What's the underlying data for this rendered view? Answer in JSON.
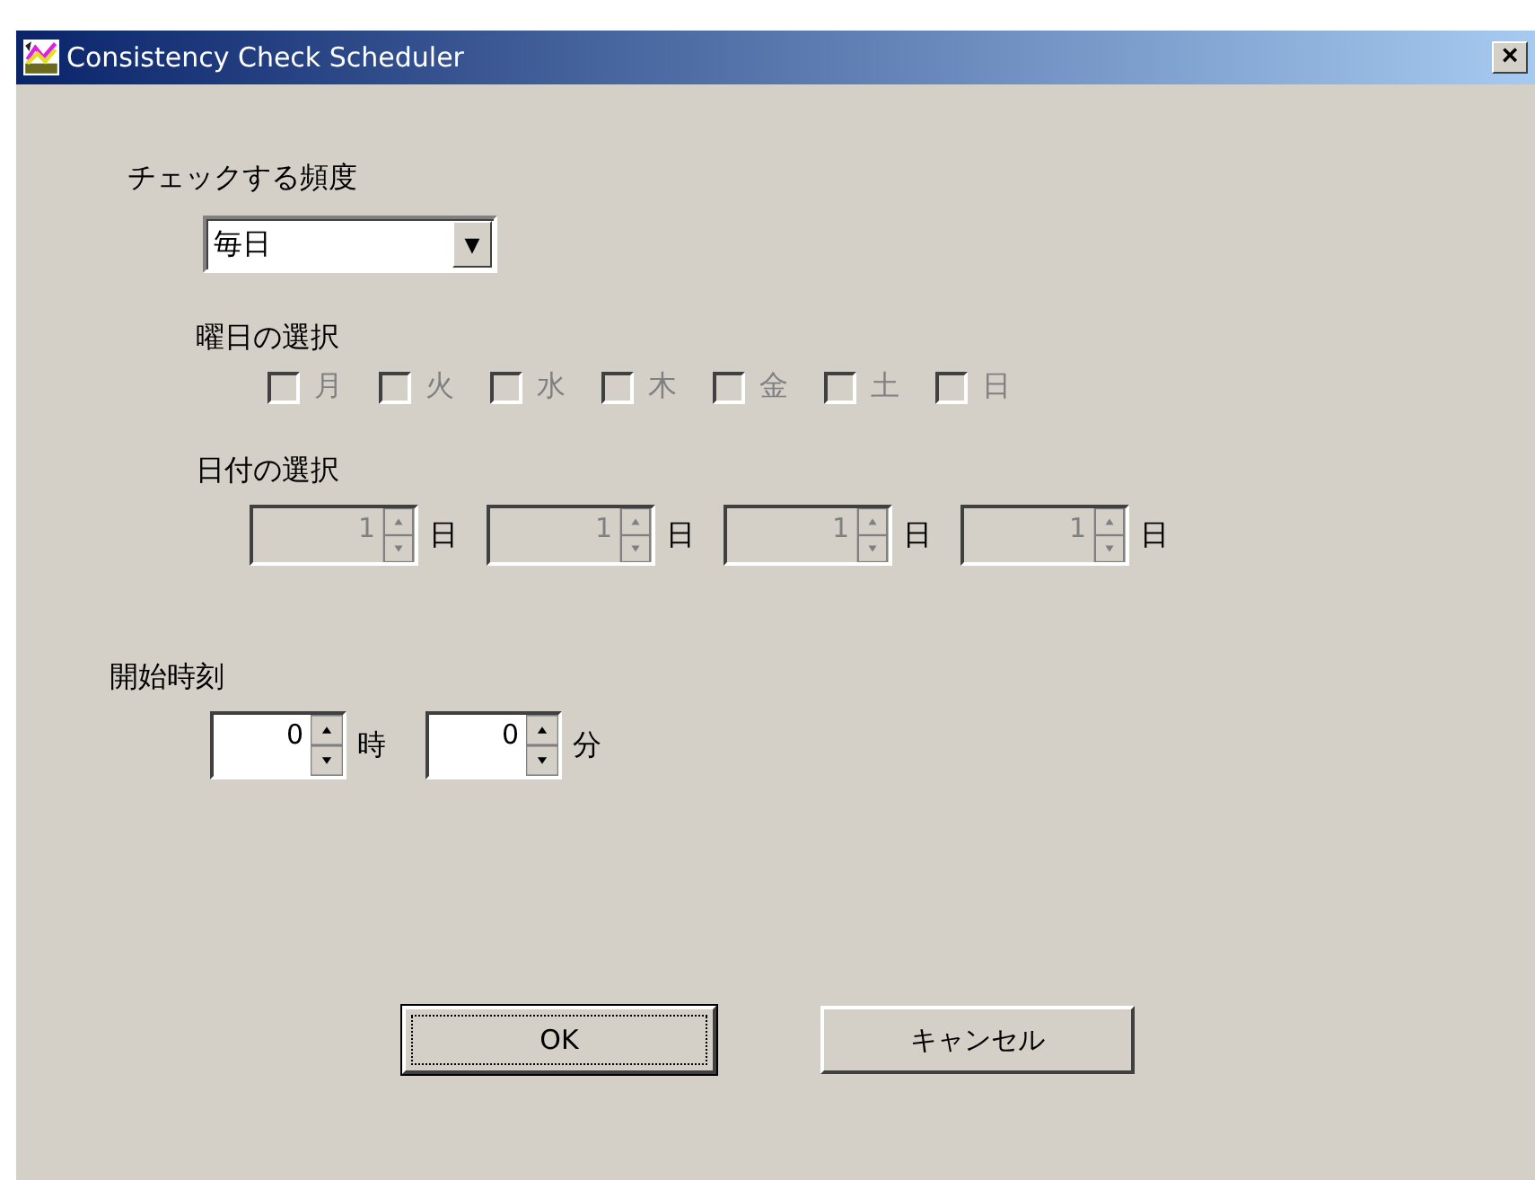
{
  "window": {
    "title": "Consistency Check Scheduler",
    "close": "×"
  },
  "frequency": {
    "label": "チェックする頻度",
    "value": "毎日",
    "arrow": "▼"
  },
  "weekdays": {
    "label": "曜日の選択",
    "disabled": true,
    "items": [
      {
        "label": "月",
        "checked": false
      },
      {
        "label": "火",
        "checked": false
      },
      {
        "label": "水",
        "checked": false
      },
      {
        "label": "木",
        "checked": false
      },
      {
        "label": "金",
        "checked": false
      },
      {
        "label": "土",
        "checked": false
      },
      {
        "label": "日",
        "checked": false
      }
    ]
  },
  "dates": {
    "label": "日付の選択",
    "disabled": true,
    "items": [
      {
        "value": "1",
        "unit": "日"
      },
      {
        "value": "1",
        "unit": "日"
      },
      {
        "value": "1",
        "unit": "日"
      },
      {
        "value": "1",
        "unit": "日"
      }
    ]
  },
  "start_time": {
    "label": "開始時刻",
    "disabled": false,
    "items": [
      {
        "value": "0",
        "unit": "時"
      },
      {
        "value": "0",
        "unit": "分"
      }
    ]
  },
  "buttons": [
    {
      "label": "OK",
      "focused": true
    },
    {
      "label": "キャンセル",
      "focused": false
    }
  ]
}
